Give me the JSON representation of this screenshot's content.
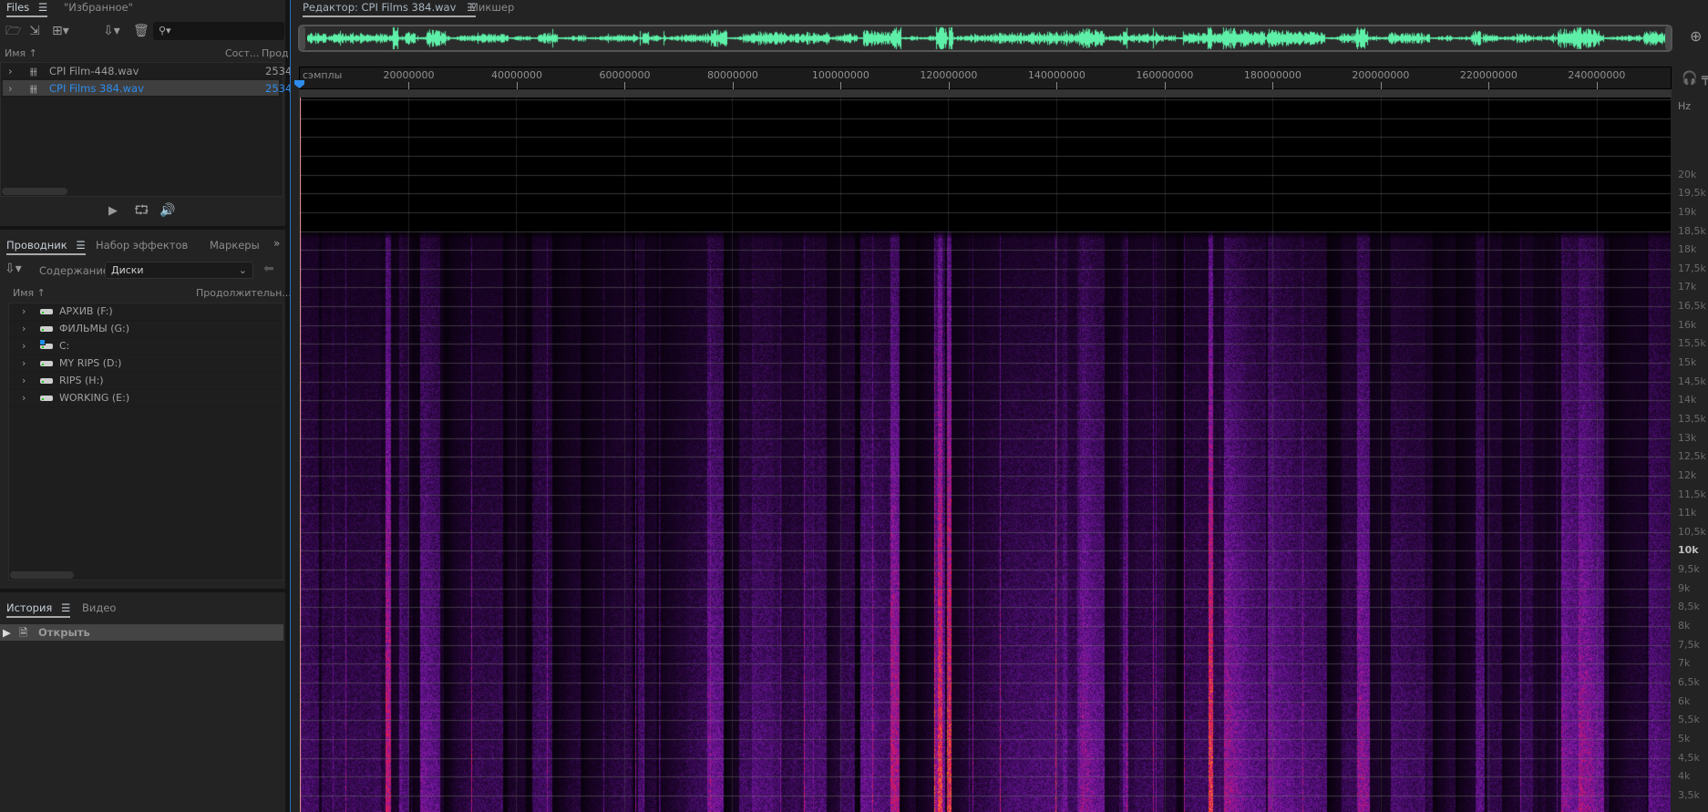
{
  "files_panel": {
    "tabs": [
      {
        "label": "Files"
      },
      {
        "label": "\"Избранное\""
      }
    ],
    "columns": {
      "name": "Имя",
      "status": "Сост...",
      "duration": "Прод"
    },
    "rows": [
      {
        "name": "CPI Film-448.wav",
        "duration": "2534",
        "selected": false
      },
      {
        "name": "CPI Films 384.wav",
        "duration": "2534",
        "selected": true
      }
    ]
  },
  "browser_panel": {
    "tabs": [
      {
        "label": "Проводник"
      },
      {
        "label": "Набор эффектов"
      },
      {
        "label": "Маркеры"
      }
    ],
    "content_label": "Содержание:",
    "content_value": "Диски",
    "columns": {
      "name": "Имя",
      "duration": "Продолжительн..."
    },
    "drives": [
      {
        "label": "АРХИВ (F:)",
        "system": false
      },
      {
        "label": "ФИЛЬМЫ (G:)",
        "system": false
      },
      {
        "label": "C:",
        "system": true
      },
      {
        "label": "MY RIPS (D:)",
        "system": false
      },
      {
        "label": "RIPS (H:)",
        "system": false
      },
      {
        "label": "WORKING (E:)",
        "system": false
      }
    ]
  },
  "history_panel": {
    "tabs": [
      {
        "label": "История"
      },
      {
        "label": "Видео"
      }
    ],
    "items": [
      {
        "label": "Открыть"
      }
    ]
  },
  "editor": {
    "tabs": [
      {
        "label": "Редактор: CPI Films 384.wav"
      },
      {
        "label": "Микшер"
      }
    ],
    "ruler": {
      "unit_label": "сэмплы",
      "ticks": [
        20000000,
        40000000,
        60000000,
        80000000,
        100000000,
        120000000,
        140000000,
        160000000,
        180000000,
        200000000,
        220000000,
        240000000
      ],
      "range": [
        0,
        253700000
      ]
    },
    "freq_axis": {
      "unit_label": "Hz",
      "ticks": [
        "20k",
        "19,5k",
        "19k",
        "18,5k",
        "18k",
        "17,5k",
        "17k",
        "16,5k",
        "16k",
        "15,5k",
        "15k",
        "14,5k",
        "14k",
        "13,5k",
        "13k",
        "12,5k",
        "12k",
        "11,5k",
        "11k",
        "10,5k",
        "10k",
        "9,5k",
        "9k",
        "8,5k",
        "8k",
        "7,5k",
        "7k",
        "6,5k",
        "6k",
        "5,5k",
        "5k",
        "4,5k",
        "4k",
        "3,5k"
      ],
      "range_hz": [
        3060,
        22050
      ]
    }
  },
  "colors": {
    "accent": "#2d8ceb",
    "waveform": "#5ef0a8",
    "selected_row": "#3f3f3f"
  }
}
